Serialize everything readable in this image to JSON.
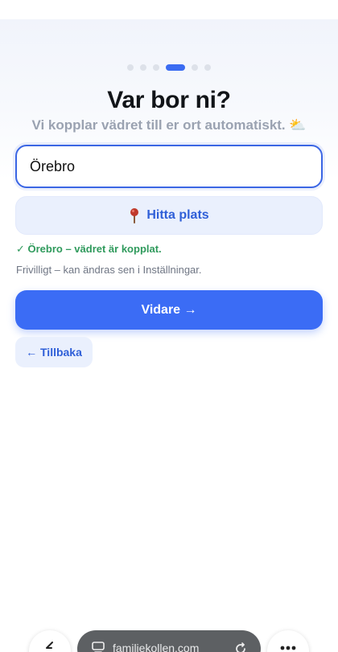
{
  "onboarding": {
    "steps_total": 6,
    "active_step": 4,
    "title": "Var bor ni?",
    "subtitle": "Vi kopplar vädret till er ort automatiskt.",
    "subtitle_icon": "⛅",
    "location_input": {
      "value": "Örebro",
      "placeholder": ""
    },
    "find_button_label": "Hitta plats",
    "status_text": "✓ Örebro – vädret är kopplat.",
    "hint_text": "Frivilligt – kan ändras sen i Inställningar.",
    "next_button_label": "Vidare →",
    "back_button_label": "← Tillbaka"
  },
  "browser": {
    "url": "familjekollen.com"
  },
  "colors": {
    "accent": "#3b6cf5",
    "success": "#2f9a5c",
    "muted": "#9aa2b1"
  },
  "icons": [
    "pin-icon",
    "weather-icon",
    "tabs-icon",
    "reload-icon",
    "back-arrow-icon",
    "more-icon"
  ]
}
